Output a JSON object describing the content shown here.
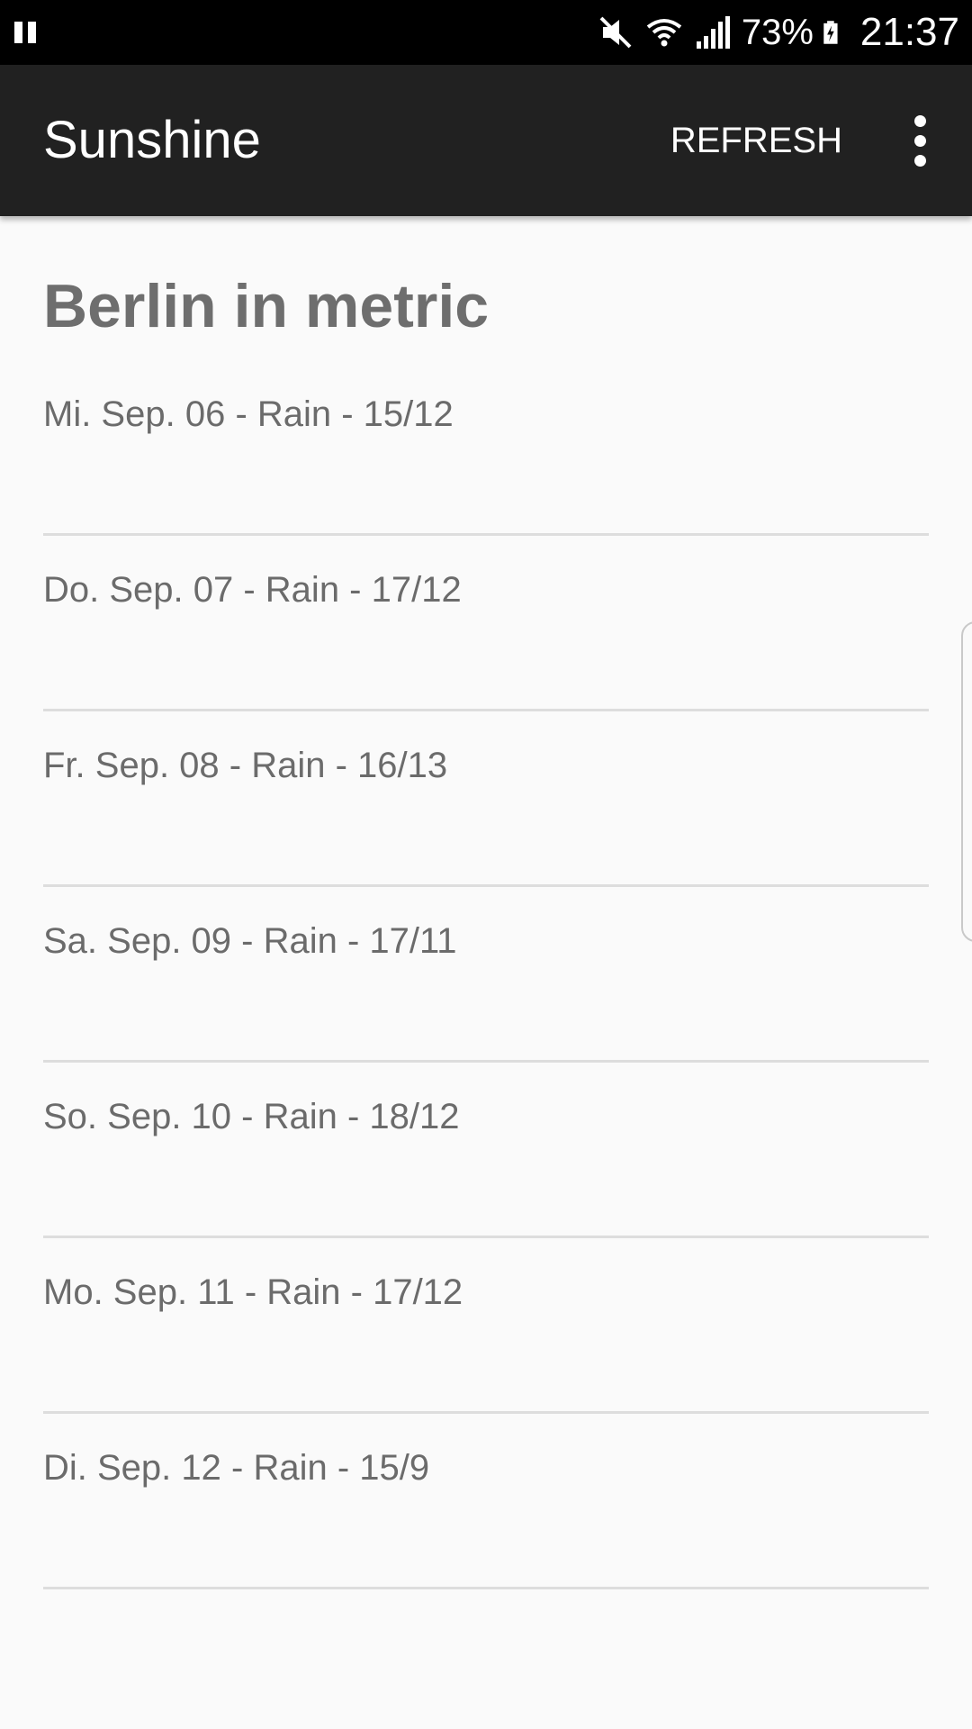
{
  "status_bar": {
    "battery_percent": "73%",
    "time": "21:37",
    "icons": [
      "pause-icon",
      "mute-icon",
      "wifi-icon",
      "signal-icon",
      "battery-charging-icon"
    ]
  },
  "app_bar": {
    "title": "Sunshine",
    "refresh_label": "REFRESH",
    "overflow_icon": "more-vert-icon",
    "background": "#212121"
  },
  "main": {
    "heading": "Berlin in metric",
    "forecast": [
      "Mi. Sep. 06 - Rain - 15/12",
      "Do. Sep. 07 - Rain - 17/12",
      "Fr. Sep. 08 - Rain - 16/13",
      "Sa. Sep. 09 - Rain - 17/11",
      "So. Sep. 10 - Rain - 18/12",
      "Mo. Sep. 11 - Rain - 17/12",
      "Di. Sep. 12 - Rain - 15/9"
    ]
  }
}
